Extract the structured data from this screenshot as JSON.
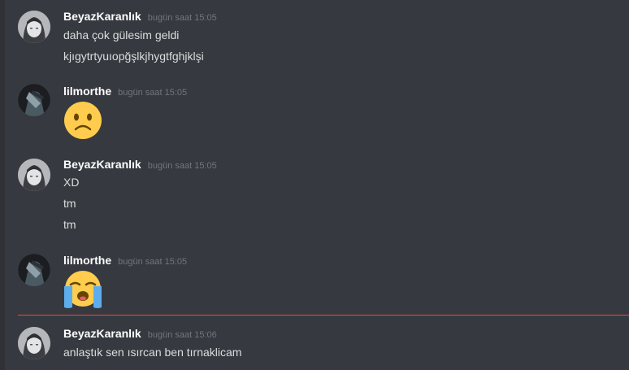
{
  "colors": {
    "background": "#36393f",
    "username": "#ffffff",
    "timestamp": "#72767d",
    "text": "#dcddde",
    "new_messages_divider": "#f04747"
  },
  "messages": [
    {
      "author": "BeyazKaranlık",
      "time": "bugün saat 15:05",
      "avatar_icon": "pale-face-avatar-icon",
      "lines": [
        "daha çok gülesim geldi",
        "kjıgytrtyuıopğşlkjhygtfghjklşi"
      ]
    },
    {
      "author": "lilmorthe",
      "time": "bugün saat 15:05",
      "avatar_icon": "dark-figure-avatar-icon",
      "emoji": "slightly-frowning-face-emoji"
    },
    {
      "author": "BeyazKaranlık",
      "time": "bugün saat 15:05",
      "avatar_icon": "pale-face-avatar-icon",
      "lines": [
        "XD",
        "tm",
        "tm"
      ]
    },
    {
      "author": "lilmorthe",
      "time": "bugün saat 15:05",
      "avatar_icon": "dark-figure-avatar-icon",
      "emoji": "loudly-crying-face-emoji"
    },
    {
      "author": "BeyazKaranlık",
      "time": "bugün saat 15:06",
      "avatar_icon": "pale-face-avatar-icon",
      "lines": [
        "anlaştık sen ısırcan ben tırnaklicam"
      ]
    }
  ]
}
